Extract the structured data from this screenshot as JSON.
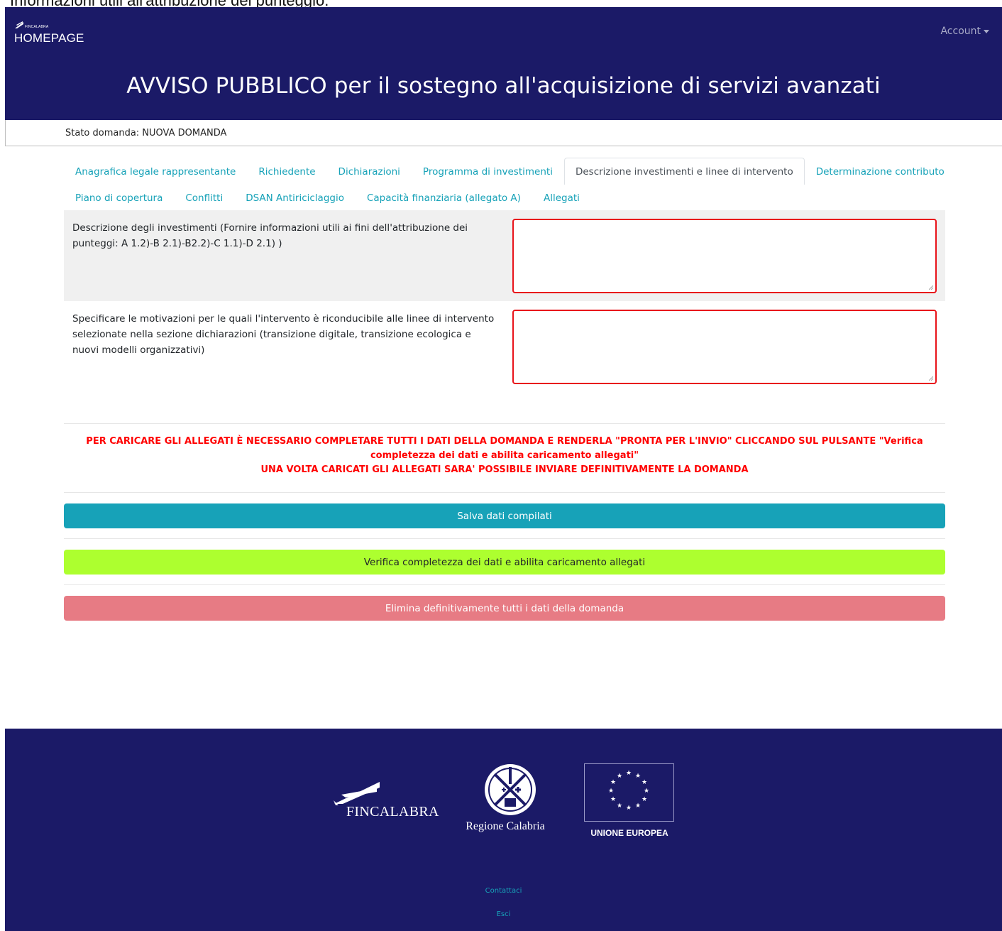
{
  "top_caption": "Informazioni utili all'attribuzione dei punteggio.",
  "navbar": {
    "logo_small_text": "FINCALABRA",
    "brand": "HOMEPAGE",
    "account_label": "Account",
    "account_icon": "caret-down-icon",
    "title": "AVVISO PUBBLICO per il sostegno all'acquisizione di servizi avanzati"
  },
  "status": {
    "text": "Stato domanda: NUOVA DOMANDA"
  },
  "tabs": {
    "row1": [
      {
        "label": "Anagrafica legale rappresentante"
      },
      {
        "label": "Richiedente"
      },
      {
        "label": "Dichiarazioni"
      },
      {
        "label": "Programma di investimenti"
      },
      {
        "label": "Descrizione investimenti e linee di intervento",
        "active": true
      },
      {
        "label": "Determinazione contributo"
      }
    ],
    "row2": [
      {
        "label": "Piano di copertura"
      },
      {
        "label": "Conflitti"
      },
      {
        "label": "DSAN Antiriciclaggio"
      },
      {
        "label": "Capacità finanziaria (allegato A)"
      },
      {
        "label": "Allegati"
      }
    ]
  },
  "form": {
    "field1": {
      "label": "Descrizione degli investimenti (Fornire informazioni utili ai fini dell'attribuzione dei punteggi: A 1.2)-B 2.1)-B2.2)-C 1.1)-D 2.1) )",
      "value": ""
    },
    "field2": {
      "label": "Specificare le motivazioni per le quali l'intervento è riconducibile alle linee di intervento selezionate nella sezione dichiarazioni (transizione digitale, transizione ecologica e nuovi modelli organizzativi)",
      "value": ""
    }
  },
  "warning": {
    "line1": "PER CARICARE GLI ALLEGATI È NECESSARIO COMPLETARE TUTTI I DATI DELLA DOMANDA E RENDERLA \"PRONTA PER L'INVIO\" CLICCANDO SUL PULSANTE \"Verifica completezza dei dati e abilita caricamento allegati\"",
    "line2": "UNA VOLTA CARICATI GLI ALLEGATI SARA' POSSIBILE INVIARE DEFINITIVAMENTE LA DOMANDA"
  },
  "buttons": {
    "save": "Salva dati compilati",
    "verify": "Verifica completezza dei dati e abilita caricamento allegati",
    "delete": "Elimina definitivamente tutti i dati della domanda"
  },
  "footer": {
    "fincalabra": "FINCALABRA",
    "regione": "Regione Calabria",
    "eu": "UNIONE EUROPEA",
    "links": {
      "contact": "Contattaci",
      "logout": "Esci"
    }
  },
  "colors": {
    "navy": "#1b1a67",
    "tab_link": "#17a2b8",
    "warning_red": "#ff0000",
    "input_border": "#e8131a",
    "save_btn": "#17a2b8",
    "verify_btn": "#adff2f",
    "delete_btn": "#e77b84"
  }
}
